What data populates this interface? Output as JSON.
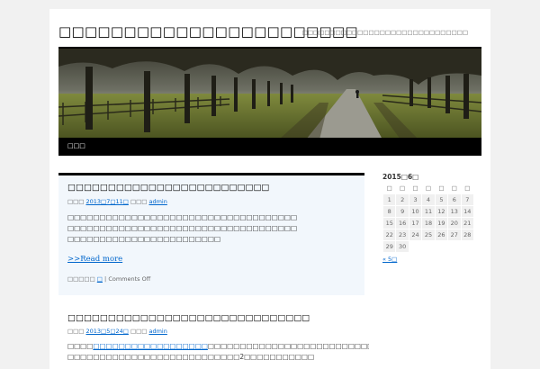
{
  "site": {
    "title": "□□□□□□□□□□□□□□□□□□□□□□□",
    "description": "□□□□□□□□□□□□□□□□□□□□□□□□□□□□□□"
  },
  "nav": {
    "home_label": "□□□"
  },
  "posts": [
    {
      "title": "□□□□□□□□□□□□□□□□□□□□□□□□□",
      "meta_prefix": "□□□",
      "date": "2013□7□11□",
      "meta_by": "□□□",
      "author": "admin",
      "content_lines": [
        "□□□□□□□□□□□□□□□□□□□□□□□□□□□□□□□□□□□□",
        "□□□□□□□□□□□□□□□□□□□□□□□□□□□□□□□□□□□□",
        "□□□□□□□□□□□□□□□□□□□□□□□□"
      ],
      "more": ">>Read more",
      "category_label": "□□□□□",
      "category": "□",
      "comments": "Comments Off"
    },
    {
      "title": "□□□□□□□□□□□□□□□□□□□□□□□□□□□□□□",
      "meta_prefix": "□□□",
      "date": "2013□5□24□",
      "meta_by": "□□□",
      "author": "admin",
      "content_line1_prefix": "□□□□",
      "content_link": "□□□□□□□□□□□□□□□□□□",
      "content_line1_rest": "□□□□□□□□□□□□□□□□□□□□□□□□□□□□□□□□□□□□□□□□□□□□□□",
      "content_line2": "□□□□□□□□□□□□□□□□□□□□□□□□□□□2□□□□□□□□□□□"
    }
  ],
  "calendar": {
    "caption": "2015□6□",
    "weekdays": [
      "□",
      "□",
      "□",
      "□",
      "□",
      "□",
      "□"
    ],
    "weeks": [
      [
        "1",
        "2",
        "3",
        "4",
        "5",
        "6",
        "7"
      ],
      [
        "8",
        "9",
        "10",
        "11",
        "12",
        "13",
        "14"
      ],
      [
        "15",
        "16",
        "17",
        "18",
        "19",
        "20",
        "21"
      ],
      [
        "22",
        "23",
        "24",
        "25",
        "26",
        "27",
        "28"
      ],
      [
        "29",
        "30",
        "",
        "",
        "",
        "",
        ""
      ]
    ],
    "prev": "« 5□"
  }
}
